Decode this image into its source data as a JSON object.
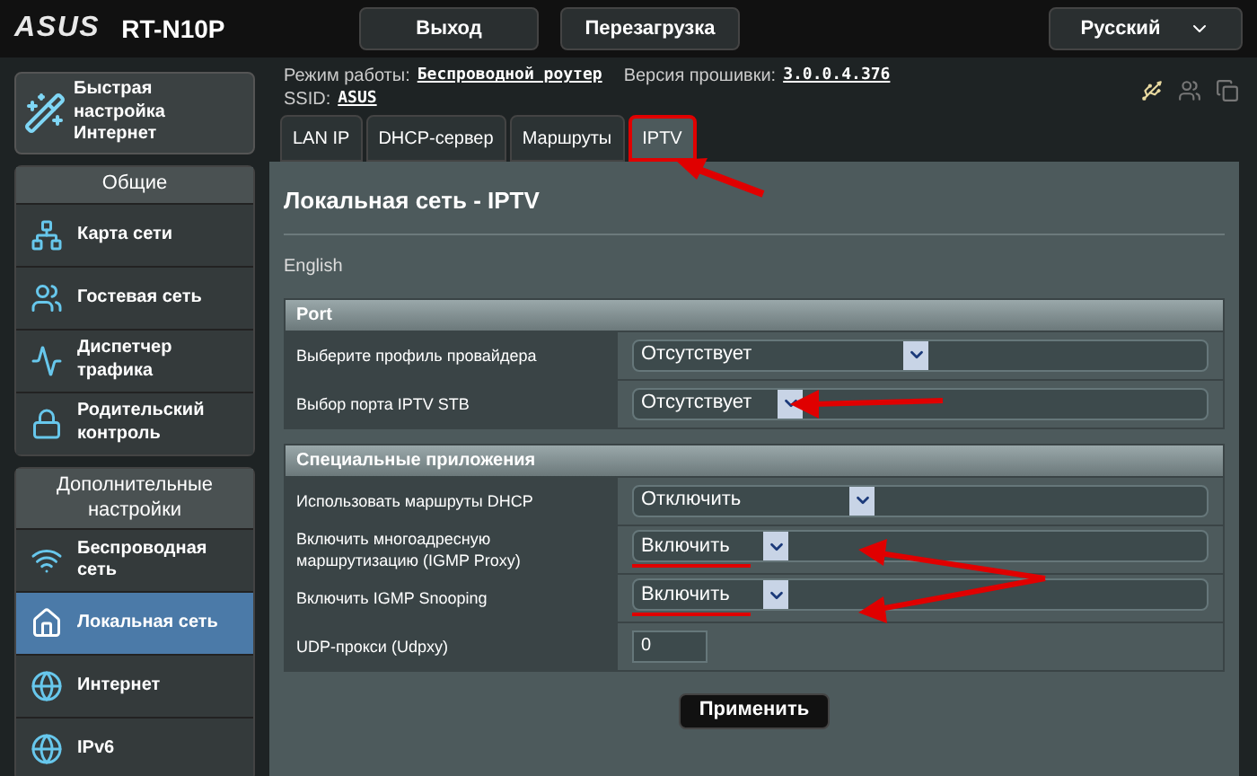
{
  "header": {
    "brand": "ASUS",
    "model": "RT-N10P",
    "buttons": [
      "Выход",
      "Перезагрузка"
    ],
    "language": "Русский"
  },
  "info": {
    "mode_label": "Режим работы:",
    "mode_value": "Беспроводной роутер",
    "firmware_label": "Версия прошивки:",
    "firmware_value": "3.0.0.4.376",
    "ssid_label": "SSID:",
    "ssid_value": "ASUS"
  },
  "quick_setup": "Быстрая настройка Интернет",
  "sidebar": [
    {
      "title": "Общие",
      "items": [
        {
          "label": "Карта сети",
          "selected": false
        },
        {
          "label": "Гостевая сеть",
          "selected": false
        },
        {
          "label": "Диспетчер трафика",
          "selected": false
        },
        {
          "label": "Родительский контроль",
          "selected": false
        }
      ]
    },
    {
      "title": "Дополнительные настройки",
      "items": [
        {
          "label": "Беспроводная сеть",
          "selected": false
        },
        {
          "label": "Локальная сеть",
          "selected": true
        },
        {
          "label": "Интернет",
          "selected": false
        },
        {
          "label": "IPv6",
          "selected": false
        }
      ]
    }
  ],
  "tabs": [
    {
      "label": "LAN IP",
      "selected": false,
      "highlighted": false
    },
    {
      "label": "DHCP-сервер",
      "selected": false,
      "highlighted": false
    },
    {
      "label": "Маршруты",
      "selected": false,
      "highlighted": false
    },
    {
      "label": "IPTV",
      "selected": true,
      "highlighted": true
    }
  ],
  "page": {
    "title": "Локальная сеть - IPTV",
    "subtitle": "English",
    "apply": "Применить"
  },
  "sections": [
    {
      "title": "Port",
      "rows": [
        {
          "label": "Выберите профиль провайдера",
          "kind": "select",
          "value": "Отсутствует",
          "highlighted": false
        },
        {
          "label": "Выбор порта IPTV STB",
          "kind": "select",
          "value": "Отсутствует",
          "highlighted": false
        }
      ]
    },
    {
      "title": "Специальные приложения",
      "rows": [
        {
          "label": "Использовать маршруты DHCP",
          "kind": "select",
          "value": "Отключить",
          "highlighted": false
        },
        {
          "label": "Включить многоадресную маршрутизацию (IGMP Proxy)",
          "kind": "select",
          "value": "Включить",
          "highlighted": true
        },
        {
          "label": "Включить IGMP Snooping",
          "kind": "select",
          "value": "Включить",
          "highlighted": true
        },
        {
          "label": "UDP-прокси (Udpxy)",
          "kind": "input",
          "value": "0",
          "highlighted": false
        }
      ]
    }
  ]
}
